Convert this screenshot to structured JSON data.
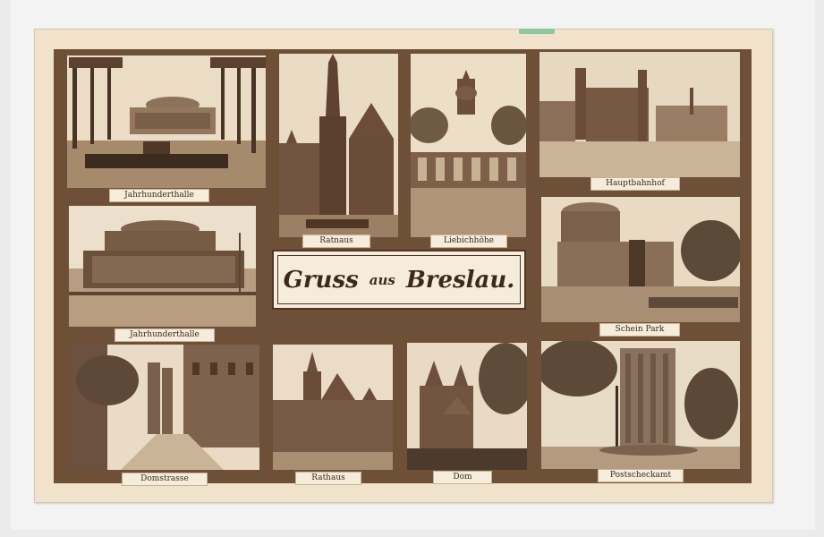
{
  "postcard": {
    "title": {
      "part1": "Gruss",
      "part2": "aus",
      "part3": "Breslau."
    },
    "captions": {
      "jahrhunderthalle_top": "Jahrhunderthalle",
      "rathaus_top": "Ratnaus",
      "liebichhoehe": "Liebichhöhe",
      "hauptbahnhof": "Hauptbahnhof",
      "jahrhunderthalle_mid": "Jahrhunderthalle",
      "schein_park": "Schein Park",
      "domstrasse": "Domstrasse",
      "rathaus_bottom": "Rathaus",
      "dom": "Dom",
      "postscheckamt": "Postscheckamt"
    }
  },
  "colors": {
    "card": "#f1e3cb",
    "mount": "#6e5038",
    "label_bg": "#f6ecdb",
    "ink": "#3b2a1c"
  },
  "icons": [
    "photo-jahrhunderthalle",
    "photo-rathaus",
    "photo-liebichhoehe",
    "photo-hauptbahnhof",
    "photo-schein-park",
    "photo-domstrasse",
    "photo-dom",
    "photo-postscheckamt"
  ]
}
